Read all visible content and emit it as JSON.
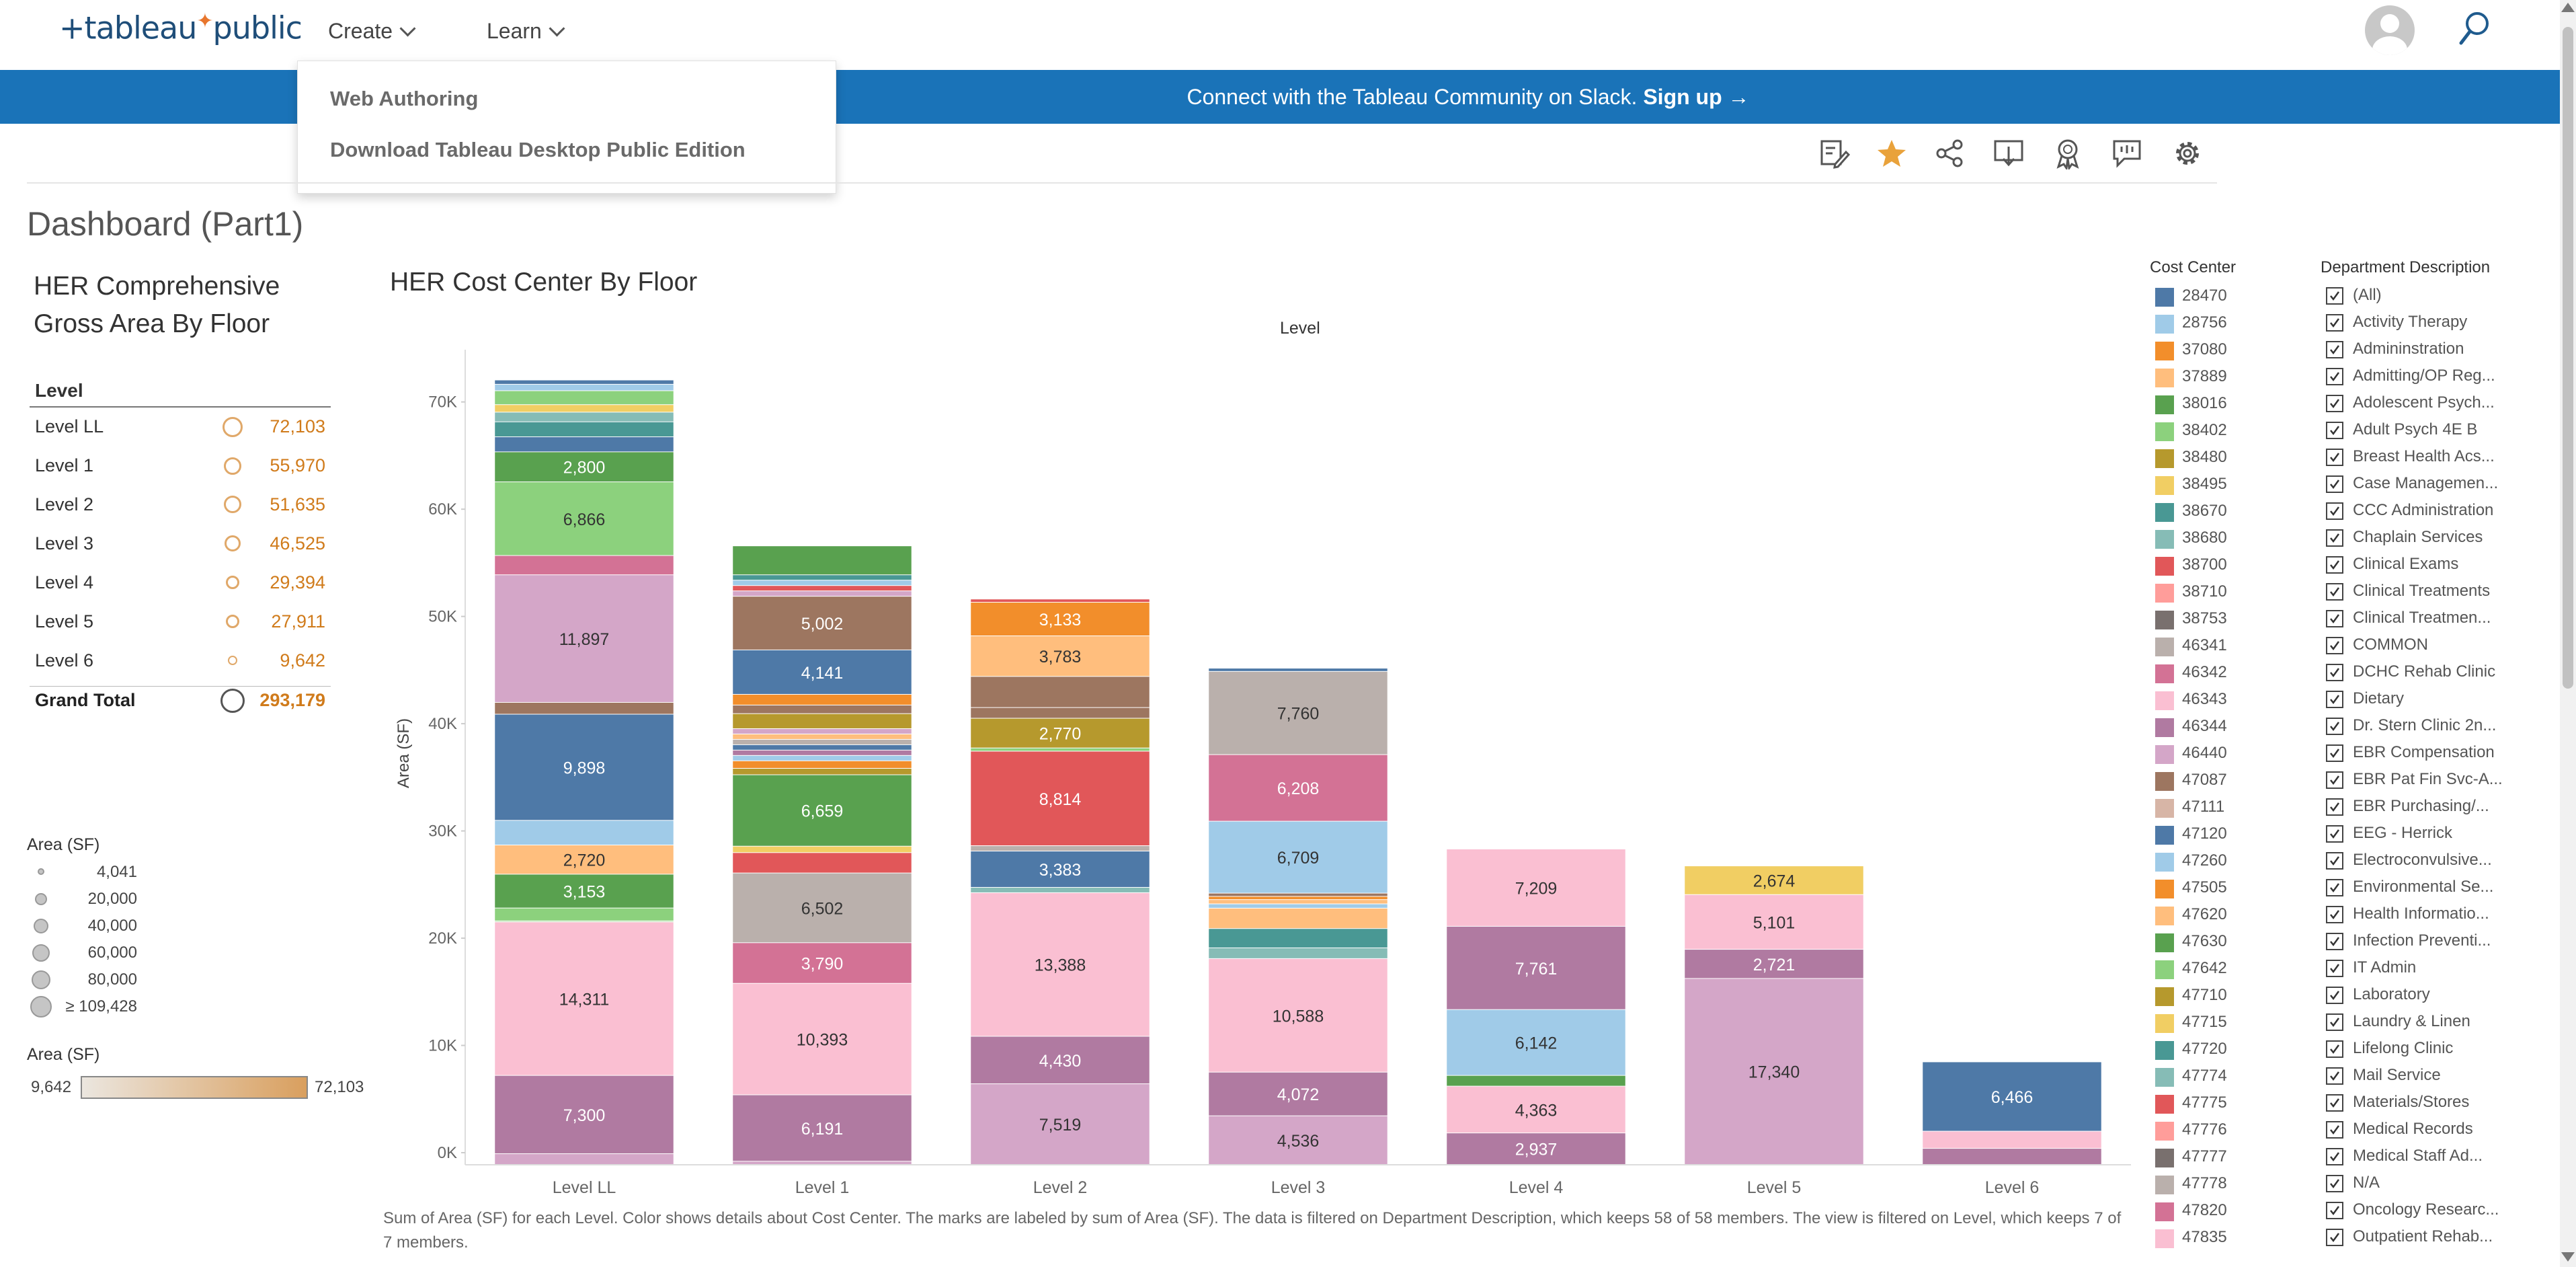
{
  "nav": {
    "logo": "+tableau+public",
    "logo_main": "+tableau",
    "logo_tail": "public",
    "menus": [
      {
        "label": "Create"
      },
      {
        "label": "Learn"
      }
    ]
  },
  "banner": {
    "text": "Connect with the Tableau Community on Slack.",
    "link": "Sign up →"
  },
  "dropdown": {
    "items": [
      {
        "label": "Web Authoring"
      },
      {
        "label": "Download Tableau Desktop Public Edition"
      }
    ]
  },
  "toolbar": {
    "icons": [
      "edit-icon",
      "favorite-star-icon",
      "share-icon",
      "download-icon",
      "badge-icon",
      "comment-icon",
      "settings-gear-icon"
    ],
    "colors": {
      "star": "#e9a23b",
      "icon": "#555555"
    }
  },
  "dashboard": {
    "title": "Dashboard (Part1)"
  },
  "left_panel": {
    "title_line1": "HER Comprehensive",
    "title_line2": "Gross Area By Floor",
    "header": "Level",
    "rows": [
      {
        "label": "Level LL",
        "value": "72,103"
      },
      {
        "label": "Level 1",
        "value": "55,970"
      },
      {
        "label": "Level 2",
        "value": "51,635"
      },
      {
        "label": "Level 3",
        "value": "46,525"
      },
      {
        "label": "Level 4",
        "value": "29,394"
      },
      {
        "label": "Level 5",
        "value": "27,911"
      },
      {
        "label": "Level 6",
        "value": "9,642"
      }
    ],
    "grand_total": {
      "label": "Grand Total",
      "value": "293,179"
    },
    "size_legend": {
      "title": "Area (SF)",
      "items": [
        "4,041",
        "20,000",
        "40,000",
        "60,000",
        "80,000",
        "≥ 109,428"
      ]
    },
    "color_legend": {
      "title": "Area (SF)",
      "min": "9,642",
      "max": "72,103",
      "color_low": "#ebe6df",
      "color_high": "#d99f5e"
    }
  },
  "chart_data": {
    "type": "bar",
    "stacked": true,
    "title": "HER Cost Center By Floor",
    "column_header": "Level",
    "xlabel": "",
    "ylabel": "Area (SF)",
    "ylim": [
      0,
      76000
    ],
    "yticks": [
      0,
      10000,
      20000,
      30000,
      40000,
      50000,
      60000,
      70000
    ],
    "ytick_labels": [
      "0K",
      "10K",
      "20K",
      "30K",
      "40K",
      "50K",
      "60K",
      "70K"
    ],
    "grid": false,
    "categories": [
      "Level LL",
      "Level 1",
      "Level 2",
      "Level 3",
      "Level 4",
      "Level 5",
      "Level 6"
    ],
    "stacks": [
      [
        {
          "v": 1000,
          "c": "#d4a6c8"
        },
        {
          "v": 7300,
          "c": "#b07aa1"
        },
        {
          "v": 14311,
          "c": "#fabfd2"
        },
        {
          "v": 100,
          "c": "#8cd17d"
        },
        {
          "v": 1200,
          "c": "#8cd17d"
        },
        {
          "v": 3153,
          "c": "#59a14f"
        },
        {
          "v": 2720,
          "c": "#ffbe7d"
        },
        {
          "v": 2300,
          "c": "#a0cbe8"
        },
        {
          "v": 9898,
          "c": "#4e79a7"
        },
        {
          "v": 1100,
          "c": "#9d7660"
        },
        {
          "v": 11897,
          "c": "#d4a6c8"
        },
        {
          "v": 1800,
          "c": "#d37295"
        },
        {
          "v": 6866,
          "c": "#8cd17d"
        },
        {
          "v": 2800,
          "c": "#59a14f"
        },
        {
          "v": 1400,
          "c": "#4e79a7"
        },
        {
          "v": 1400,
          "c": "#499894"
        },
        {
          "v": 900,
          "c": "#86bcb6"
        },
        {
          "v": 700,
          "c": "#f1ce63"
        },
        {
          "v": 1300,
          "c": "#8cd17d"
        },
        {
          "v": 600,
          "c": "#a0cbe8"
        },
        {
          "v": 400,
          "c": "#4e79a7"
        }
      ],
      [
        {
          "v": 300,
          "c": "#d4a6c8"
        },
        {
          "v": 6191,
          "c": "#b07aa1"
        },
        {
          "v": 10393,
          "c": "#fabfd2"
        },
        {
          "v": 3790,
          "c": "#d37295"
        },
        {
          "v": 6502,
          "c": "#bab0ac"
        },
        {
          "v": 1900,
          "c": "#e15759"
        },
        {
          "v": 600,
          "c": "#f1ce63"
        },
        {
          "v": 6659,
          "c": "#59a14f"
        },
        {
          "v": 600,
          "c": "#b6992d"
        },
        {
          "v": 700,
          "c": "#f28e2b"
        },
        {
          "v": 500,
          "c": "#a0cbe8"
        },
        {
          "v": 500,
          "c": "#b07aa1"
        },
        {
          "v": 500,
          "c": "#4e79a7"
        },
        {
          "v": 500,
          "c": "#bab0ac"
        },
        {
          "v": 500,
          "c": "#ffbe7d"
        },
        {
          "v": 500,
          "c": "#d4a6c8"
        },
        {
          "v": 1400,
          "c": "#b6992d"
        },
        {
          "v": 800,
          "c": "#9d7660"
        },
        {
          "v": 1000,
          "c": "#f28e2b"
        },
        {
          "v": 4141,
          "c": "#4e79a7"
        },
        {
          "v": 5002,
          "c": "#9d7660"
        },
        {
          "v": 500,
          "c": "#d4a6c8"
        },
        {
          "v": 500,
          "c": "#e15759"
        },
        {
          "v": 500,
          "c": "#a0cbe8"
        },
        {
          "v": 500,
          "c": "#499894"
        },
        {
          "v": 2700,
          "c": "#59a14f"
        }
      ],
      [
        {
          "v": 7519,
          "c": "#d4a6c8"
        },
        {
          "v": 4430,
          "c": "#b07aa1"
        },
        {
          "v": 13388,
          "c": "#fabfd2"
        },
        {
          "v": 500,
          "c": "#86bcb6"
        },
        {
          "v": 3383,
          "c": "#4e79a7"
        },
        {
          "v": 500,
          "c": "#bab0ac"
        },
        {
          "v": 8814,
          "c": "#e15759"
        },
        {
          "v": 300,
          "c": "#8cd17d"
        },
        {
          "v": 2770,
          "c": "#b6992d"
        },
        {
          "v": 1000,
          "c": "#9d7660"
        },
        {
          "v": 2900,
          "c": "#9d7660"
        },
        {
          "v": 3783,
          "c": "#ffbe7d"
        },
        {
          "v": 3133,
          "c": "#f28e2b"
        },
        {
          "v": 300,
          "c": "#e15759"
        }
      ],
      [
        {
          "v": 4536,
          "c": "#d4a6c8"
        },
        {
          "v": 4072,
          "c": "#b07aa1"
        },
        {
          "v": 10588,
          "c": "#fabfd2"
        },
        {
          "v": 1000,
          "c": "#86bcb6"
        },
        {
          "v": 1800,
          "c": "#499894"
        },
        {
          "v": 1900,
          "c": "#ffbe7d"
        },
        {
          "v": 400,
          "c": "#a0cbe8"
        },
        {
          "v": 400,
          "c": "#ffbe7d"
        },
        {
          "v": 300,
          "c": "#f28e2b"
        },
        {
          "v": 300,
          "c": "#9d7660"
        },
        {
          "v": 6709,
          "c": "#a0cbe8"
        },
        {
          "v": 6208,
          "c": "#d37295"
        },
        {
          "v": 7760,
          "c": "#bab0ac"
        },
        {
          "v": 300,
          "c": "#4e79a7"
        }
      ],
      [
        {
          "v": 2937,
          "c": "#b07aa1"
        },
        {
          "v": 4363,
          "c": "#fabfd2"
        },
        {
          "v": 1000,
          "c": "#59a14f"
        },
        {
          "v": 6142,
          "c": "#a0cbe8"
        },
        {
          "v": 7761,
          "c": "#b07aa1"
        },
        {
          "v": 7209,
          "c": "#fabfd2"
        }
      ],
      [
        {
          "v": 17340,
          "c": "#d4a6c8"
        },
        {
          "v": 2721,
          "c": "#b07aa1"
        },
        {
          "v": 5101,
          "c": "#fabfd2"
        },
        {
          "v": 2674,
          "c": "#f1ce63"
        }
      ],
      [
        {
          "v": 1500,
          "c": "#b07aa1"
        },
        {
          "v": 1600,
          "c": "#fabfd2"
        },
        {
          "v": 6466,
          "c": "#4e79a7"
        }
      ]
    ],
    "labels": [
      [
        {
          "i": 1,
          "t": "7,300"
        },
        {
          "i": 2,
          "t": "14,311"
        },
        {
          "i": 5,
          "t": "3,153"
        },
        {
          "i": 6,
          "t": "2,720"
        },
        {
          "i": 8,
          "t": "9,898"
        },
        {
          "i": 10,
          "t": "11,897"
        },
        {
          "i": 12,
          "t": "6,866"
        },
        {
          "i": 13,
          "t": "2,800"
        }
      ],
      [
        {
          "i": 1,
          "t": "6,191"
        },
        {
          "i": 2,
          "t": "10,393"
        },
        {
          "i": 3,
          "t": "3,790"
        },
        {
          "i": 4,
          "t": "6,502"
        },
        {
          "i": 7,
          "t": "6,659"
        },
        {
          "i": 19,
          "t": "4,141"
        },
        {
          "i": 20,
          "t": "5,002"
        }
      ],
      [
        {
          "i": 0,
          "t": "7,519"
        },
        {
          "i": 1,
          "t": "4,430"
        },
        {
          "i": 2,
          "t": "13,388"
        },
        {
          "i": 4,
          "t": "3,383"
        },
        {
          "i": 6,
          "t": "8,814"
        },
        {
          "i": 8,
          "t": "2,770"
        },
        {
          "i": 11,
          "t": "3,783"
        },
        {
          "i": 12,
          "t": "3,133"
        }
      ],
      [
        {
          "i": 0,
          "t": "4,536"
        },
        {
          "i": 1,
          "t": "4,072"
        },
        {
          "i": 2,
          "t": "10,588"
        },
        {
          "i": 10,
          "t": "6,709"
        },
        {
          "i": 11,
          "t": "6,208"
        },
        {
          "i": 12,
          "t": "7,760"
        }
      ],
      [
        {
          "i": 0,
          "t": "2,937"
        },
        {
          "i": 1,
          "t": "4,363"
        },
        {
          "i": 3,
          "t": "6,142"
        },
        {
          "i": 4,
          "t": "7,761"
        },
        {
          "i": 5,
          "t": "7,209"
        }
      ],
      [
        {
          "i": 0,
          "t": "17,340"
        },
        {
          "i": 1,
          "t": "2,721"
        },
        {
          "i": 2,
          "t": "5,101"
        },
        {
          "i": 3,
          "t": "2,674"
        }
      ],
      [
        {
          "i": 2,
          "t": "6,466"
        }
      ]
    ],
    "caption": "Sum of Area (SF) for each Level.  Color shows details about Cost Center.  The marks are labeled by sum of Area (SF). The data is filtered on Department Description, which keeps 58 of 58 members. The view is filtered on Level, which keeps 7 of 7 members."
  },
  "cost_center_legend": {
    "title": "Cost Center",
    "items": [
      {
        "label": "28470",
        "color": "#4e79a7"
      },
      {
        "label": "28756",
        "color": "#a0cbe8"
      },
      {
        "label": "37080",
        "color": "#f28e2b"
      },
      {
        "label": "37889",
        "color": "#ffbe7d"
      },
      {
        "label": "38016",
        "color": "#59a14f"
      },
      {
        "label": "38402",
        "color": "#8cd17d"
      },
      {
        "label": "38480",
        "color": "#b6992d"
      },
      {
        "label": "38495",
        "color": "#f1ce63"
      },
      {
        "label": "38670",
        "color": "#499894"
      },
      {
        "label": "38680",
        "color": "#86bcb6"
      },
      {
        "label": "38700",
        "color": "#e15759"
      },
      {
        "label": "38710",
        "color": "#ff9d9a"
      },
      {
        "label": "38753",
        "color": "#79706e"
      },
      {
        "label": "46341",
        "color": "#bab0ac"
      },
      {
        "label": "46342",
        "color": "#d37295"
      },
      {
        "label": "46343",
        "color": "#fabfd2"
      },
      {
        "label": "46344",
        "color": "#b07aa1"
      },
      {
        "label": "46440",
        "color": "#d4a6c8"
      },
      {
        "label": "47087",
        "color": "#9d7660"
      },
      {
        "label": "47111",
        "color": "#d7b5a6"
      },
      {
        "label": "47120",
        "color": "#4e79a7"
      },
      {
        "label": "47260",
        "color": "#a0cbe8"
      },
      {
        "label": "47505",
        "color": "#f28e2b"
      },
      {
        "label": "47620",
        "color": "#ffbe7d"
      },
      {
        "label": "47630",
        "color": "#59a14f"
      },
      {
        "label": "47642",
        "color": "#8cd17d"
      },
      {
        "label": "47710",
        "color": "#b6992d"
      },
      {
        "label": "47715",
        "color": "#f1ce63"
      },
      {
        "label": "47720",
        "color": "#499894"
      },
      {
        "label": "47774",
        "color": "#86bcb6"
      },
      {
        "label": "47775",
        "color": "#e15759"
      },
      {
        "label": "47776",
        "color": "#ff9d9a"
      },
      {
        "label": "47777",
        "color": "#79706e"
      },
      {
        "label": "47778",
        "color": "#bab0ac"
      },
      {
        "label": "47820",
        "color": "#d37295"
      },
      {
        "label": "47835",
        "color": "#fabfd2"
      }
    ]
  },
  "department_legend": {
    "title": "Department Description",
    "items": [
      "(All)",
      "Activity Therapy",
      "Admininstration",
      "Admitting/OP Reg...",
      "Adolescent Psych...",
      "Adult Psych 4E B",
      "Breast Health Acs...",
      "Case Managemen...",
      "CCC Administration",
      "Chaplain Services",
      "Clinical Exams",
      "Clinical Treatments",
      "Clinical Treatmen...",
      "COMMON",
      "DCHC Rehab Clinic",
      "Dietary",
      "Dr. Stern Clinic 2n...",
      "EBR Compensation",
      "EBR Pat Fin Svc-A...",
      "EBR Purchasing/...",
      "EEG - Herrick",
      "Electroconvulsive...",
      "Environmental Se...",
      "Health Informatio...",
      "Infection Preventi...",
      "IT Admin",
      "Laboratory",
      "Laundry & Linen",
      "Lifelong Clinic",
      "Mail Service",
      "Materials/Stores",
      "Medical Records",
      "Medical Staff Ad...",
      "N/A",
      "Oncology Researc...",
      "Outpatient Rehab..."
    ]
  }
}
